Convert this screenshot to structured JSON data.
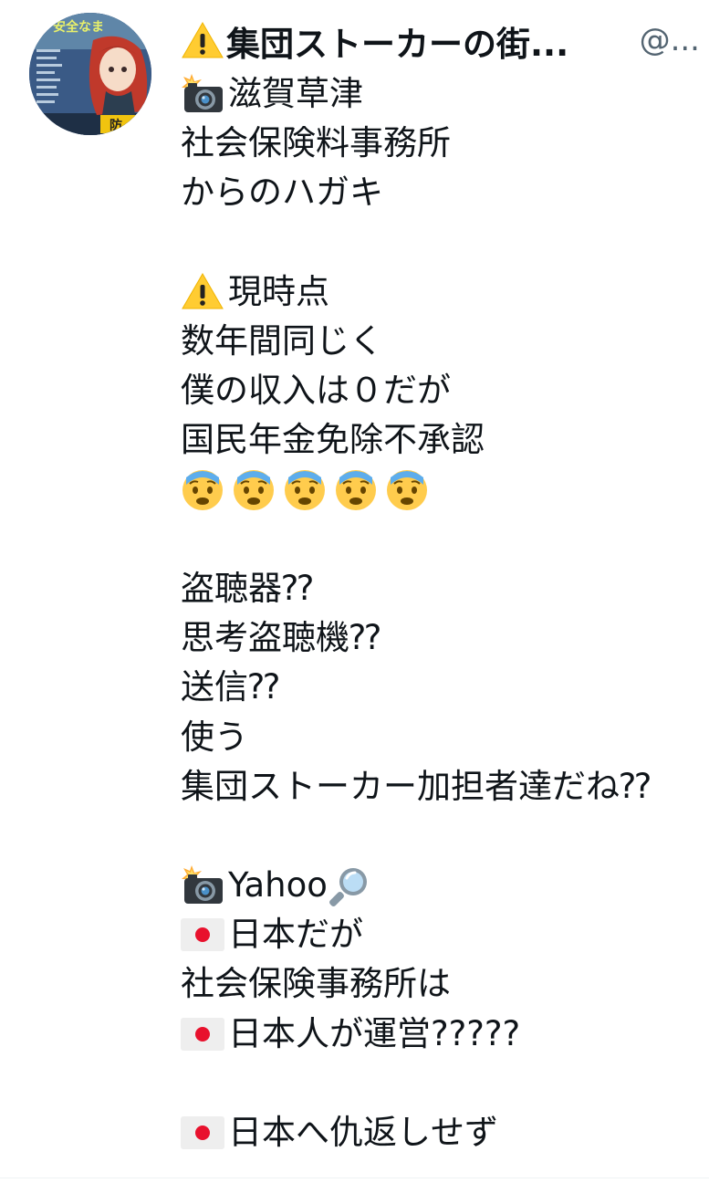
{
  "tweet": {
    "display_name": "集団ストーカーの街...",
    "handle": "@...",
    "lines": {
      "l1": "滋賀草津",
      "l2": "社会保険料事務所",
      "l3": "からのハガキ",
      "l4": "現時点",
      "l5": "数年間同じく",
      "l6": "僕の収入は０だが",
      "l7": "国民年金免除不承認",
      "l8": "盗聴器⁇",
      "l9": "思考盗聴機⁇",
      "l10": "送信⁇",
      "l11": "使う",
      "l12": "集団ストーカー加担者達だね⁇",
      "l13": "Yahoo",
      "l14": "日本だが",
      "l15": "社会保険事務所は",
      "l16": "日本人が運営?????",
      "l17": "日本へ仇返しせず"
    },
    "avatar_text": {
      "banner": "安全なま",
      "badge": "防"
    }
  },
  "icons": {
    "warning": "warning-icon",
    "camera_flash": "camera-flash-icon",
    "fearful_face": "fearful-face-icon",
    "magnifier": "magnifying-glass-icon",
    "japan_flag": "japan-flag-icon"
  },
  "colors": {
    "text": "#0f1419",
    "handle": "#536471",
    "warning_yellow": "#ffcc32",
    "flag_red": "#e8112d",
    "emoji_face": "#ffcc4d"
  }
}
